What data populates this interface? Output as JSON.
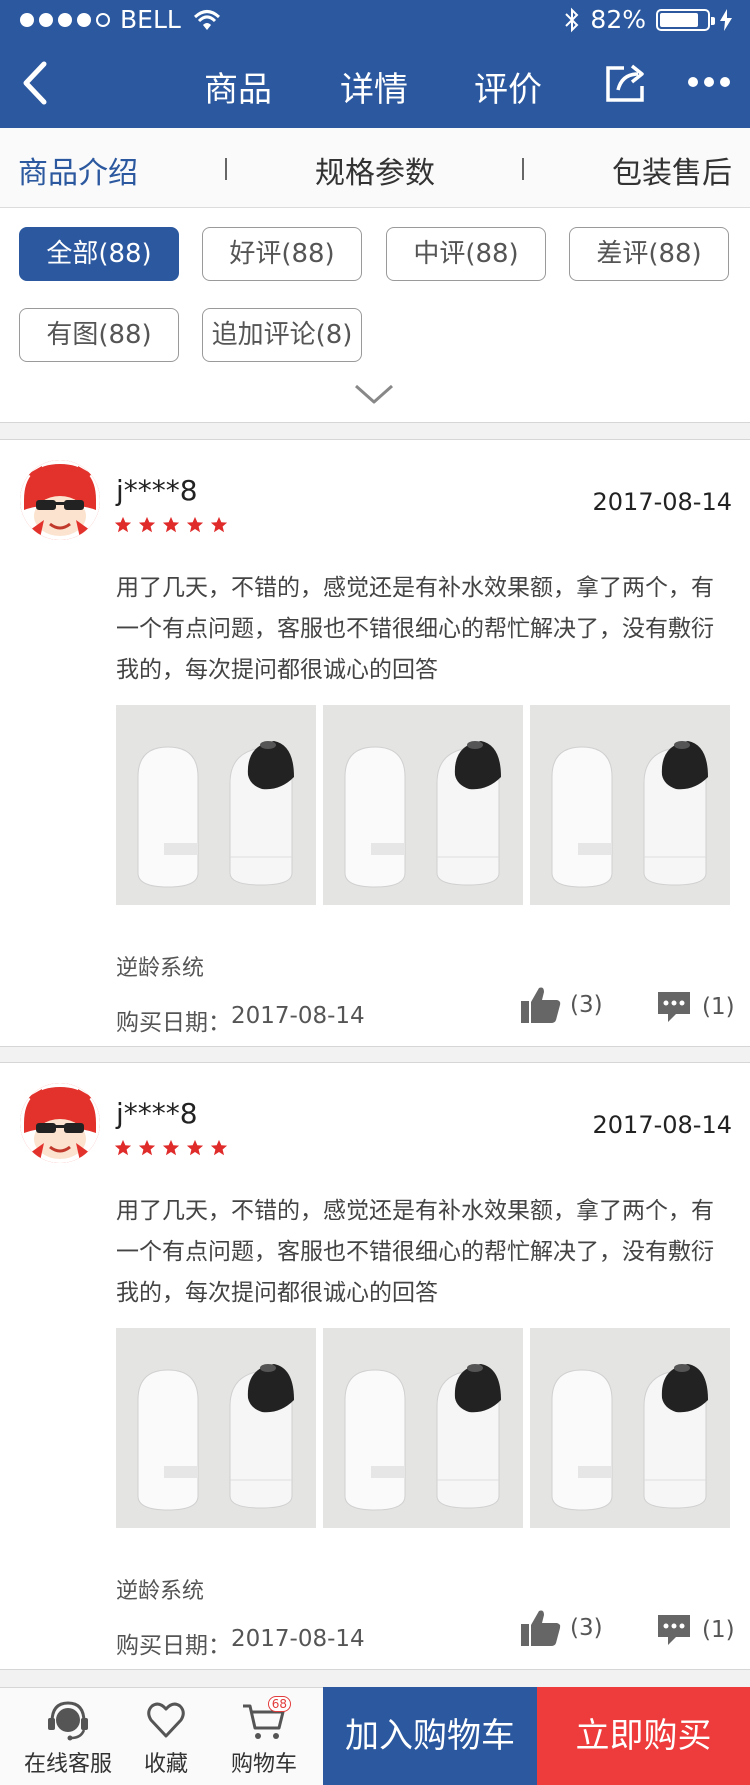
{
  "status_bar": {
    "carrier": "BELL",
    "battery_text": "82%",
    "battery_level": 0.82
  },
  "nav": {
    "tabs": [
      "商品",
      "详情",
      "评价"
    ]
  },
  "section_tabs": [
    "商品介绍",
    "规格参数",
    "包装售后"
  ],
  "filters": {
    "chips": [
      "全部(88)",
      "好评(88)",
      "中评(88)",
      "差评(88)",
      "有图(88)",
      "追加评论(8)"
    ],
    "active_index": 0
  },
  "reviews": [
    {
      "username": "j****8",
      "date": "2017-08-14",
      "rating": 5,
      "text": "用了几天，不错的，感觉还是有补水效果额，拿了两个，有一个有点问题，客服也不错很细心的帮忙解决了，没有敷衍我的，每次提问都很诚心的回答",
      "spec": "逆龄系统",
      "purchase_label": "购买日期：",
      "purchase_date": "2017-08-14",
      "likes": "(3)",
      "comments": "(1)"
    },
    {
      "username": "j****8",
      "date": "2017-08-14",
      "rating": 5,
      "text": "用了几天，不错的，感觉还是有补水效果额，拿了两个，有一个有点问题，客服也不错很细心的帮忙解决了，没有敷衍我的，每次提问都很诚心的回答",
      "spec": "逆龄系统",
      "purchase_label": "购买日期：",
      "purchase_date": "2017-08-14",
      "likes": "(3)",
      "comments": "(1)"
    }
  ],
  "bottom_bar": {
    "service": "在线客服",
    "favorite": "收藏",
    "cart": "购物车",
    "cart_badge": "68",
    "add_to_cart": "加入购物车",
    "buy_now": "立即购买"
  },
  "colors": {
    "primary": "#2b589f",
    "danger": "#ee3b3b",
    "star": "#e02b2b"
  },
  "icons": [
    "back-icon",
    "share-icon",
    "more-icon",
    "chevron-down-icon",
    "thumbs-up-icon",
    "comment-icon",
    "headset-icon",
    "heart-icon",
    "cart-icon",
    "wifi-icon",
    "bluetooth-icon",
    "battery-icon",
    "charging-icon"
  ]
}
